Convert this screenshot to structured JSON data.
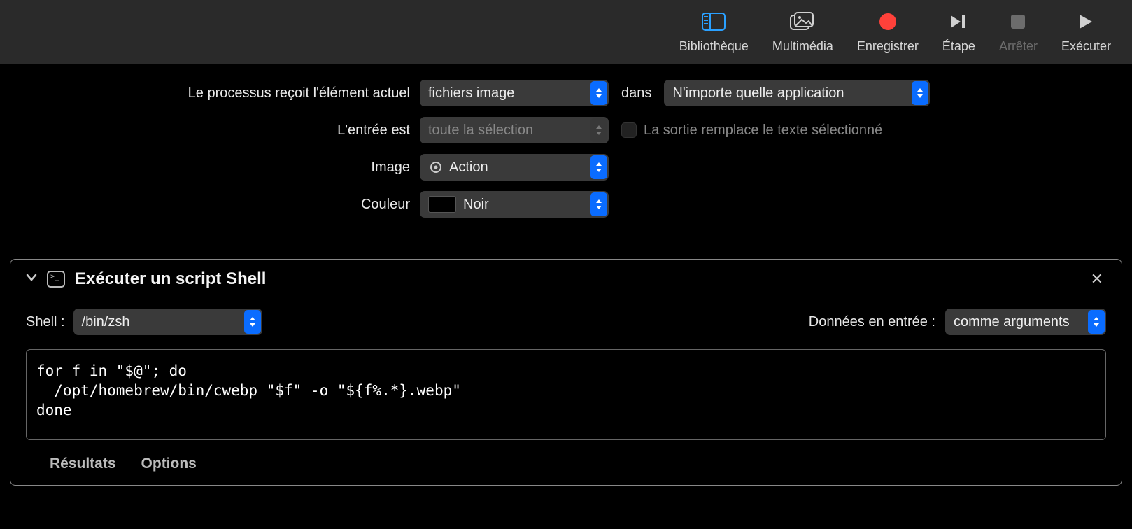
{
  "toolbar": {
    "library": "Bibliothèque",
    "media": "Multimédia",
    "record": "Enregistrer",
    "step": "Étape",
    "stop": "Arrêter",
    "run": "Exécuter"
  },
  "config": {
    "receives_label": "Le processus reçoit l'élément actuel",
    "receives_value": "fichiers image",
    "in_label": "dans",
    "app_value": "N'importe quelle application",
    "input_is_label": "L'entrée est",
    "input_is_value": "toute la sélection",
    "replace_checkbox_label": "La sortie remplace le texte sélectionné",
    "image_label": "Image",
    "image_value": "Action",
    "color_label": "Couleur",
    "color_value": "Noir"
  },
  "action": {
    "title": "Exécuter un script Shell",
    "shell_label": "Shell :",
    "shell_value": "/bin/zsh",
    "input_label": "Données en entrée :",
    "input_value": "comme arguments",
    "script": "for f in \"$@\"; do\n  /opt/homebrew/bin/cwebp \"$f\" -o \"${f%.*}.webp\"\ndone",
    "footer_results": "Résultats",
    "footer_options": "Options"
  }
}
